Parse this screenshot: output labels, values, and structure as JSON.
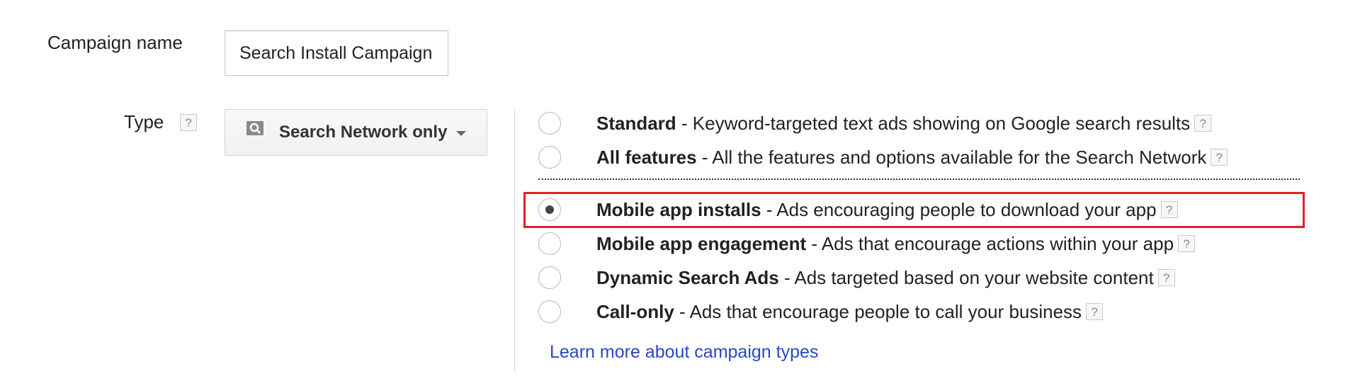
{
  "campaign_name": {
    "label": "Campaign name",
    "value": "Search Install Campaign"
  },
  "type": {
    "label": "Type",
    "help_icon": "?",
    "dropdown": {
      "icon": "search-network-icon",
      "label": "Search Network only"
    }
  },
  "options": [
    {
      "name": "Standard",
      "description": "- Keyword-targeted text ads showing on Google search results",
      "help": "?",
      "selected": false
    },
    {
      "name": "All features",
      "description": "- All the features and options available for the Search Network",
      "help": "?",
      "selected": false
    },
    {
      "name": "Mobile app installs",
      "description": "- Ads encouraging people to download your app",
      "help": "?",
      "selected": true
    },
    {
      "name": "Mobile app engagement",
      "description": "- Ads that encourage actions within your app",
      "help": "?",
      "selected": false
    },
    {
      "name": "Dynamic Search Ads",
      "description": "- Ads targeted based on your website content",
      "help": "?",
      "selected": false
    },
    {
      "name": "Call-only",
      "description": "- Ads that encourage people to call your business",
      "help": "?",
      "selected": false
    }
  ],
  "learn_more_link": "Learn more about campaign types",
  "colors": {
    "highlight": "#e0212a",
    "link": "#2a47c4"
  }
}
